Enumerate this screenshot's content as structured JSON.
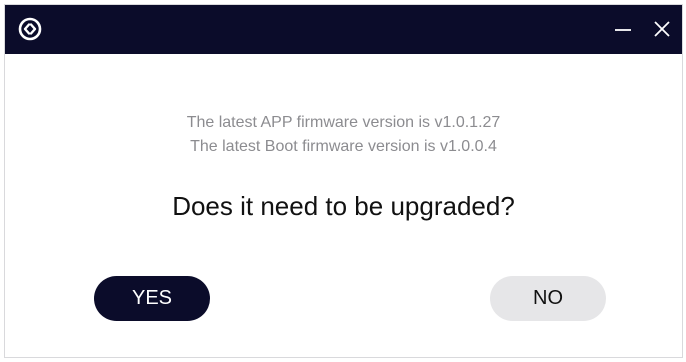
{
  "titlebar": {
    "logo_icon": "app-logo-icon",
    "minimize_icon": "minimize-icon",
    "close_icon": "close-icon",
    "background_color": "#0b0c2a"
  },
  "dialog": {
    "message_lines": [
      "The latest APP firmware version is v1.0.1.27",
      "The latest Boot firmware version is v1.0.0.4"
    ],
    "question": "Does it need to be upgraded?",
    "yes_label": "YES",
    "no_label": "NO"
  },
  "colors": {
    "primary_button": "#0b0c2a",
    "secondary_button": "#e6e6e8",
    "message_text": "#8c8c90"
  }
}
